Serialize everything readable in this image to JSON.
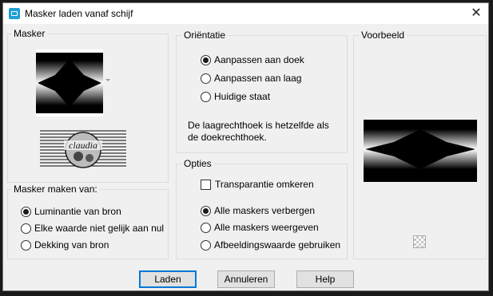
{
  "window": {
    "title": "Masker laden vanaf schijf",
    "close_glyph": "✕"
  },
  "mask_group": {
    "legend": "Masker",
    "logo_text": "claudia"
  },
  "source_group": {
    "legend": "Masker maken van:",
    "options": [
      {
        "label": "Luminantie van bron",
        "checked": true
      },
      {
        "label": "Elke waarde niet gelijk aan nul",
        "checked": false
      },
      {
        "label": "Dekking van bron",
        "checked": false
      }
    ]
  },
  "orientation_group": {
    "legend": "Oriëntatie",
    "options": [
      {
        "label": "Aanpassen aan doek",
        "checked": true
      },
      {
        "label": "Aanpassen aan laag",
        "checked": false
      },
      {
        "label": "Huidige staat",
        "checked": false
      }
    ],
    "info_line1": "De laagrechthoek is hetzelfde als",
    "info_line2": "de doekrechthoek."
  },
  "options_group": {
    "legend": "Opties",
    "invert_label": "Transparantie omkeren",
    "invert_checked": false,
    "options": [
      {
        "label": "Alle maskers verbergen",
        "checked": true
      },
      {
        "label": "Alle maskers weergeven",
        "checked": false
      },
      {
        "label": "Afbeeldingswaarde gebruiken",
        "checked": false
      }
    ]
  },
  "preview_group": {
    "legend": "Voorbeeld"
  },
  "buttons": {
    "ok": "Laden",
    "cancel": "Annuleren",
    "help": "Help"
  },
  "icons": {
    "app": "camera-icon",
    "close": "close-icon",
    "dropdown": "chevron-down-icon",
    "transparency": "checkerboard-icon"
  }
}
